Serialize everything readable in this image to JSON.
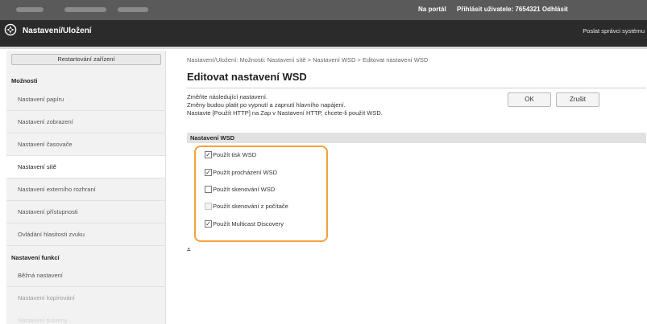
{
  "topbar": {
    "portal_link": "Na portál",
    "user_label": "Přihlásit uživatele:  7654321  Odhlásit"
  },
  "header": {
    "title": "Nastavení/Uložení",
    "admin_link": "Poslat správci systému"
  },
  "sidebar": {
    "restart_button": "Restartování zařízení",
    "section1": "Možnosti",
    "items": [
      {
        "label": "Nastavení papíru"
      },
      {
        "label": "Nastavení zobrazení"
      },
      {
        "label": "Nastavení časovače"
      },
      {
        "label": "Nastavení sítě"
      },
      {
        "label": "Nastavení externího rozhraní"
      },
      {
        "label": "Nastavení přístupnosti"
      },
      {
        "label": "Ovládání hlasitosti zvuku"
      }
    ],
    "section2": "Nastavení funkcí",
    "items2": [
      {
        "label": "Běžná nastavení"
      },
      {
        "label": "Nastavení kopírování"
      },
      {
        "label": "Nastavení tiskárny"
      }
    ],
    "active_index": 3
  },
  "main": {
    "breadcrumb": "Nastavení/Uložení: Možnosti: Nastavení sítě > Nastavení WSD > Editovat nastavení WSD",
    "page_title": "Editovat nastavení WSD",
    "info_lines": [
      "Změňte následující nastavení.",
      "Změny budou platit po vypnutí a zapnutí hlavního napájení.",
      "Nastavte [Použít HTTP] na Zap v Nastavení HTTP, chcete-li použít WSD."
    ],
    "ok_button": "OK",
    "cancel_button": "Zrušit",
    "section_title": "Nastavení WSD",
    "options": [
      {
        "label": "Použít tisk WSD",
        "checked": true,
        "disabled": false
      },
      {
        "label": "Použít procházení WSD",
        "checked": true,
        "disabled": false
      },
      {
        "label": "Použít skenování WSD",
        "checked": false,
        "disabled": false
      },
      {
        "label": "Použít skenování z počítače",
        "checked": false,
        "disabled": true
      },
      {
        "label": "Použít Multicast Discovery",
        "checked": true,
        "disabled": false
      }
    ],
    "collapse_glyph": "⩡"
  },
  "colors": {
    "topbar": "#5a5a5a",
    "titlebar": "#2b2b2b",
    "highlight": "#f5a13a",
    "section_bar": "#e1e1e1"
  }
}
